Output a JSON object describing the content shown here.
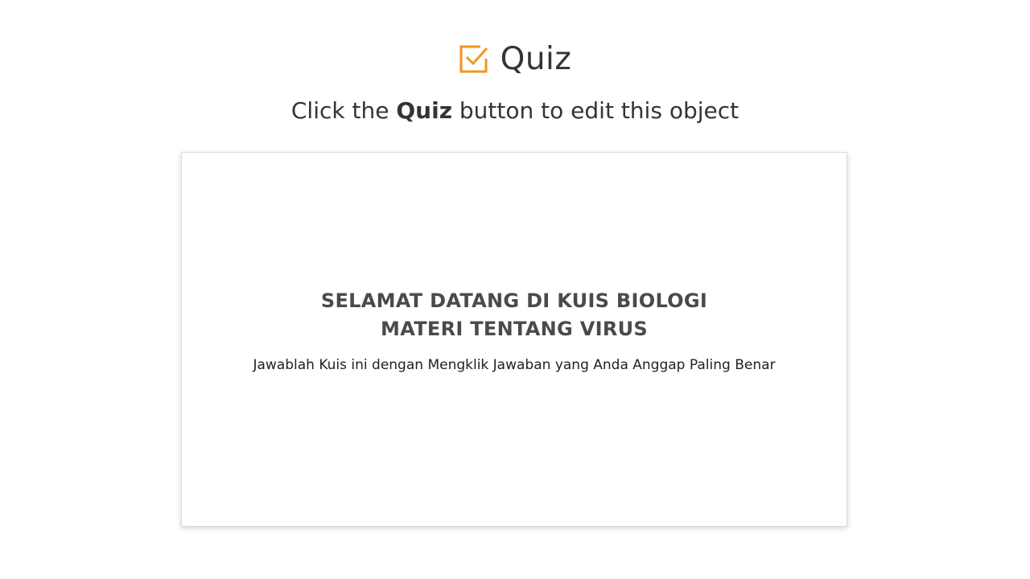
{
  "header": {
    "icon": "checkbox-checked-icon",
    "icon_color": "#f0961e",
    "title": "Quiz"
  },
  "instruction": {
    "prefix": "Click the ",
    "bold": "Quiz",
    "suffix": " button to edit this object"
  },
  "slide": {
    "heading_line1": "SELAMAT DATANG DI KUIS BIOLOGI",
    "heading_line2": "MATERI TENTANG VIRUS",
    "subtext": "Jawablah Kuis ini dengan Mengklik Jawaban yang Anda Anggap Paling Benar"
  }
}
